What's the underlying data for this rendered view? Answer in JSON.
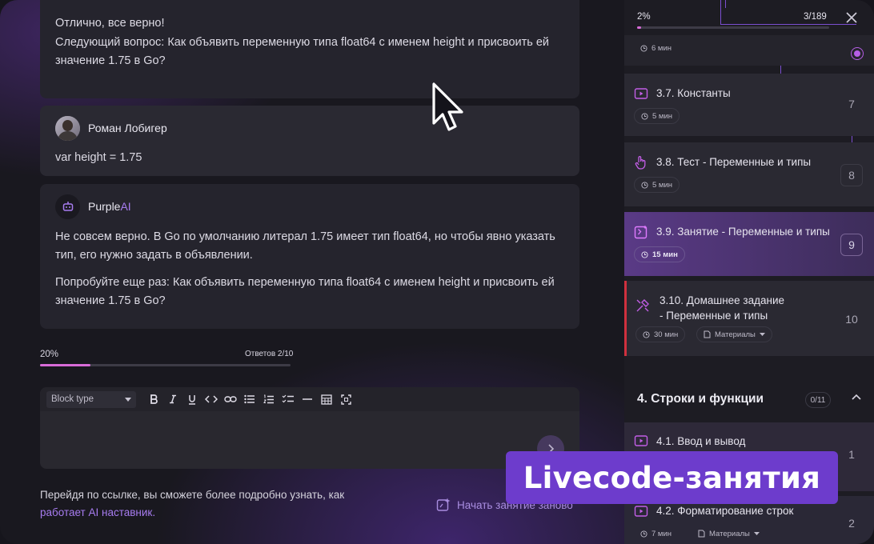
{
  "chat": {
    "messages": [
      {
        "lines": [
          "Отлично, все верно!",
          "Следующий вопрос: Как объявить переменную типа float64 с именем height и присвоить ей значение 1.75 в Go?"
        ]
      },
      {
        "author": "Роман Лобигер",
        "text": "var height = 1.75"
      },
      {
        "author_main": "Purple",
        "author_accent": "AI",
        "lines": [
          "Не совсем верно. В Go по умолчанию литерал 1.75 имеет тип float64, но чтобы явно указать тип, его нужно задать в объявлении.",
          "Попробуйте еще раз: Как объявить переменную типа float64 с именем height и присвоить ей значение 1.75 в Go?"
        ]
      }
    ],
    "progress": {
      "label": "20%",
      "value": 0.2,
      "count_label": "Ответов 2/10"
    },
    "editor": {
      "block_type": "Block type",
      "toolbar": [
        "bold-icon",
        "italic-icon",
        "underline-icon",
        "code-icon",
        "link-icon",
        "bullet-list-icon",
        "numbered-list-icon",
        "checklist-icon",
        "horizontal-rule-icon",
        "table-icon",
        "fullscreen-icon"
      ]
    },
    "footer": {
      "text": "Перейдя по ссылке, вы сможете более подробно узнать, как",
      "link": "работает AI наставник."
    },
    "restart_label": "Начать занятие заново"
  },
  "sidebar": {
    "progress": {
      "label": "2%",
      "value": 0.02,
      "count": "3/189"
    },
    "lessons": [
      {
        "duration": "6 мин",
        "icon": "clock-icon"
      },
      {
        "title": "3.7. Константы",
        "duration": "5 мин",
        "number": "7",
        "icon": "video-icon"
      },
      {
        "title": "3.8. Тест - Переменные и типы",
        "duration": "5 мин",
        "number": "8",
        "icon": "hand-pointer-icon"
      },
      {
        "title": "3.9. Занятие - Переменные и типы",
        "duration": "15 мин",
        "number": "9",
        "icon": "code-exercise-icon"
      },
      {
        "title_lines": [
          "3.10. Домашнее задание",
          "- Переменные и типы"
        ],
        "duration": "30 мин",
        "materials": "Материалы",
        "number": "10",
        "icon": "tools-icon"
      }
    ],
    "section": {
      "title": "4. Строки и функции",
      "count": "0/11"
    },
    "section_lessons": [
      {
        "title": "4.1. Ввод и вывод",
        "number": "1",
        "icon": "video-icon"
      },
      {
        "title": "4.2. Форматирование строк",
        "duration": "7 мин",
        "materials": "Материалы",
        "number": "2",
        "icon": "video-icon"
      }
    ]
  },
  "badge": "Livecode-занятия",
  "colors": {
    "accent": "#a77cf0",
    "progress": "#d86bd8",
    "badge": "#6d3ccc",
    "active_marker": "#d0303e"
  }
}
